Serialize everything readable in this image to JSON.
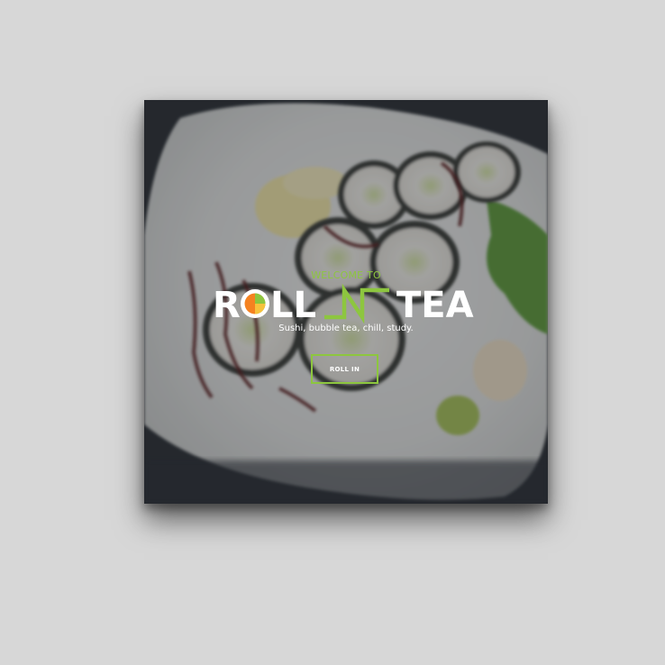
{
  "hero": {
    "welcome_text": "WELCOME TO",
    "logo_text": "ROLL N TEA",
    "tagline": "Sushi, bubble tea, chill, study.",
    "cta_label": "ROLL IN"
  },
  "colors": {
    "background": "#d7d7d7",
    "accent_green": "#8dc63f",
    "logo_orange": "#f58220",
    "logo_white": "#ffffff"
  }
}
